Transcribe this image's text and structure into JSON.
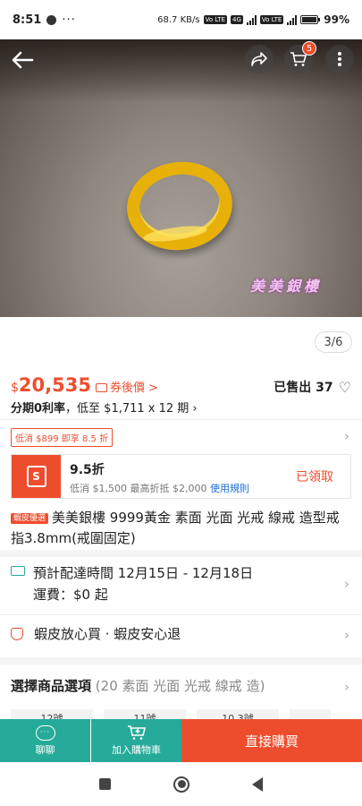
{
  "status_bar": {
    "time": "8:51",
    "more": "···",
    "net_speed": "68.7 KB/s",
    "net_tags": [
      "Vo LTE",
      "4G",
      "Vo LTE"
    ],
    "battery": "99%"
  },
  "hero": {
    "watermark": "美美銀樓",
    "cart_count": "5",
    "pager": "3/6"
  },
  "price": {
    "currency": "$",
    "amount": "20,535",
    "coupon_link": "券後價 >",
    "sold": "已售出 37",
    "installment_bold": "分期0利率",
    "installment_rest": "，低至 $1,711 x 12 期 ›",
    "min_spend_chip": "低消 $899 即享 8.5 折"
  },
  "voucher": {
    "title": "9.5折",
    "desc": "低消 $1,500 最高折抵 $2,000",
    "rules": "使用規則",
    "claimed": "已領取"
  },
  "product": {
    "mall_tag": "蝦皮優選",
    "title": "美美銀樓 9999黃金 素面 光面 光戒 線戒 造型戒指3.8mm(戒圍固定)"
  },
  "shipping": {
    "delivery": "預計配達時間 12月15日 - 12月18日",
    "fee": "運費：$0 起"
  },
  "guarantee": {
    "text": "蝦皮放心買 · 蝦皮安心退"
  },
  "options": {
    "label": "選擇商品選項",
    "sub": "(20 素面 光面 光戒 線戒 造)",
    "chips": [
      "12號",
      "11號",
      "10.3號",
      ""
    ]
  },
  "actions": {
    "chat": "聊聊",
    "add_to_cart": "加入購物車",
    "buy_now": "直接購買"
  },
  "colors": {
    "accent": "#ee4d2d",
    "teal": "#26aa99"
  }
}
